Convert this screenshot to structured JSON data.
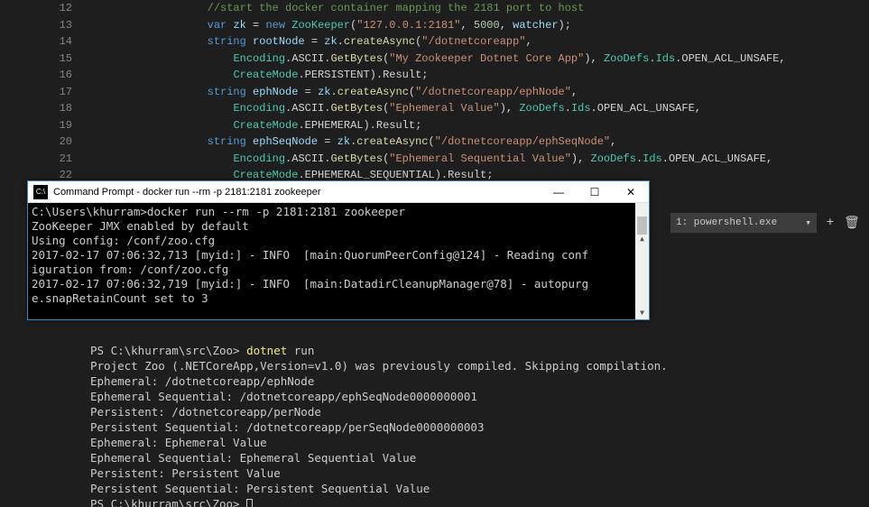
{
  "editor": {
    "lines": [
      {
        "n": 12,
        "indent": "                  ",
        "tokens": [
          {
            "cls": "c-comment",
            "t": "//start the docker container mapping the 2181 port to host"
          }
        ]
      },
      {
        "n": 13,
        "indent": "                  ",
        "tokens": [
          {
            "cls": "c-keyword",
            "t": "var"
          },
          {
            "cls": "c-punct",
            "t": " "
          },
          {
            "cls": "c-ident",
            "t": "zk"
          },
          {
            "cls": "c-punct",
            "t": " = "
          },
          {
            "cls": "c-keyword",
            "t": "new"
          },
          {
            "cls": "c-punct",
            "t": " "
          },
          {
            "cls": "c-type",
            "t": "ZooKeeper"
          },
          {
            "cls": "c-punct",
            "t": "("
          },
          {
            "cls": "c-string",
            "t": "\"127.0.0.1:2181\""
          },
          {
            "cls": "c-punct",
            "t": ", "
          },
          {
            "cls": "c-number",
            "t": "5000"
          },
          {
            "cls": "c-punct",
            "t": ", "
          },
          {
            "cls": "c-ident",
            "t": "watcher"
          },
          {
            "cls": "c-punct",
            "t": ");"
          }
        ]
      },
      {
        "n": 14,
        "indent": "                  ",
        "tokens": [
          {
            "cls": "c-keyword",
            "t": "string"
          },
          {
            "cls": "c-punct",
            "t": " "
          },
          {
            "cls": "c-ident",
            "t": "rootNode"
          },
          {
            "cls": "c-punct",
            "t": " = "
          },
          {
            "cls": "c-ident",
            "t": "zk"
          },
          {
            "cls": "c-punct",
            "t": "."
          },
          {
            "cls": "c-method",
            "t": "createAsync"
          },
          {
            "cls": "c-punct",
            "t": "("
          },
          {
            "cls": "c-string",
            "t": "\"/dotnetcoreapp\""
          },
          {
            "cls": "c-punct",
            "t": ","
          }
        ]
      },
      {
        "n": 15,
        "indent": "                      ",
        "tokens": [
          {
            "cls": "c-type",
            "t": "Encoding"
          },
          {
            "cls": "c-punct",
            "t": "."
          },
          {
            "cls": "c-member",
            "t": "ASCII"
          },
          {
            "cls": "c-punct",
            "t": "."
          },
          {
            "cls": "c-method",
            "t": "GetBytes"
          },
          {
            "cls": "c-punct",
            "t": "("
          },
          {
            "cls": "c-string",
            "t": "\"My Zookeeper Dotnet Core App\""
          },
          {
            "cls": "c-punct",
            "t": "), "
          },
          {
            "cls": "c-type",
            "t": "ZooDefs"
          },
          {
            "cls": "c-punct",
            "t": "."
          },
          {
            "cls": "c-type",
            "t": "Ids"
          },
          {
            "cls": "c-punct",
            "t": "."
          },
          {
            "cls": "c-member",
            "t": "OPEN_ACL_UNSAFE"
          },
          {
            "cls": "c-punct",
            "t": ","
          }
        ]
      },
      {
        "n": 16,
        "indent": "                      ",
        "tokens": [
          {
            "cls": "c-type",
            "t": "CreateMode"
          },
          {
            "cls": "c-punct",
            "t": "."
          },
          {
            "cls": "c-member",
            "t": "PERSISTENT"
          },
          {
            "cls": "c-punct",
            "t": ")."
          },
          {
            "cls": "c-member",
            "t": "Result"
          },
          {
            "cls": "c-punct",
            "t": ";"
          }
        ]
      },
      {
        "n": 17,
        "indent": "                  ",
        "tokens": [
          {
            "cls": "c-keyword",
            "t": "string"
          },
          {
            "cls": "c-punct",
            "t": " "
          },
          {
            "cls": "c-ident",
            "t": "ephNode"
          },
          {
            "cls": "c-punct",
            "t": " = "
          },
          {
            "cls": "c-ident",
            "t": "zk"
          },
          {
            "cls": "c-punct",
            "t": "."
          },
          {
            "cls": "c-method",
            "t": "createAsync"
          },
          {
            "cls": "c-punct",
            "t": "("
          },
          {
            "cls": "c-string",
            "t": "\"/dotnetcoreapp/ephNode\""
          },
          {
            "cls": "c-punct",
            "t": ","
          }
        ]
      },
      {
        "n": 18,
        "indent": "                      ",
        "tokens": [
          {
            "cls": "c-type",
            "t": "Encoding"
          },
          {
            "cls": "c-punct",
            "t": "."
          },
          {
            "cls": "c-member",
            "t": "ASCII"
          },
          {
            "cls": "c-punct",
            "t": "."
          },
          {
            "cls": "c-method",
            "t": "GetBytes"
          },
          {
            "cls": "c-punct",
            "t": "("
          },
          {
            "cls": "c-string",
            "t": "\"Ephemeral Value\""
          },
          {
            "cls": "c-punct",
            "t": "), "
          },
          {
            "cls": "c-type",
            "t": "ZooDefs"
          },
          {
            "cls": "c-punct",
            "t": "."
          },
          {
            "cls": "c-type",
            "t": "Ids"
          },
          {
            "cls": "c-punct",
            "t": "."
          },
          {
            "cls": "c-member",
            "t": "OPEN_ACL_UNSAFE"
          },
          {
            "cls": "c-punct",
            "t": ","
          }
        ]
      },
      {
        "n": 19,
        "indent": "                      ",
        "tokens": [
          {
            "cls": "c-type",
            "t": "CreateMode"
          },
          {
            "cls": "c-punct",
            "t": "."
          },
          {
            "cls": "c-member",
            "t": "EPHEMERAL"
          },
          {
            "cls": "c-punct",
            "t": ")."
          },
          {
            "cls": "c-member",
            "t": "Result"
          },
          {
            "cls": "c-punct",
            "t": ";"
          }
        ]
      },
      {
        "n": 20,
        "indent": "                  ",
        "tokens": [
          {
            "cls": "c-keyword",
            "t": "string"
          },
          {
            "cls": "c-punct",
            "t": " "
          },
          {
            "cls": "c-ident",
            "t": "ephSeqNode"
          },
          {
            "cls": "c-punct",
            "t": " = "
          },
          {
            "cls": "c-ident",
            "t": "zk"
          },
          {
            "cls": "c-punct",
            "t": "."
          },
          {
            "cls": "c-method",
            "t": "createAsync"
          },
          {
            "cls": "c-punct",
            "t": "("
          },
          {
            "cls": "c-string",
            "t": "\"/dotnetcoreapp/ephSeqNode\""
          },
          {
            "cls": "c-punct",
            "t": ","
          }
        ]
      },
      {
        "n": 21,
        "indent": "                      ",
        "tokens": [
          {
            "cls": "c-type",
            "t": "Encoding"
          },
          {
            "cls": "c-punct",
            "t": "."
          },
          {
            "cls": "c-member",
            "t": "ASCII"
          },
          {
            "cls": "c-punct",
            "t": "."
          },
          {
            "cls": "c-method",
            "t": "GetBytes"
          },
          {
            "cls": "c-punct",
            "t": "("
          },
          {
            "cls": "c-string",
            "t": "\"Ephemeral Sequential Value\""
          },
          {
            "cls": "c-punct",
            "t": "), "
          },
          {
            "cls": "c-type",
            "t": "ZooDefs"
          },
          {
            "cls": "c-punct",
            "t": "."
          },
          {
            "cls": "c-type",
            "t": "Ids"
          },
          {
            "cls": "c-punct",
            "t": "."
          },
          {
            "cls": "c-member",
            "t": "OPEN_ACL_UNSAFE"
          },
          {
            "cls": "c-punct",
            "t": ","
          }
        ]
      },
      {
        "n": 22,
        "indent": "                      ",
        "tokens": [
          {
            "cls": "c-type",
            "t": "CreateMode"
          },
          {
            "cls": "c-punct",
            "t": "."
          },
          {
            "cls": "c-member",
            "t": "EPHEMERAL_SEQUENTIAL"
          },
          {
            "cls": "c-punct",
            "t": ")."
          },
          {
            "cls": "c-member",
            "t": "Result"
          },
          {
            "cls": "c-punct",
            "t": ";"
          }
        ]
      }
    ]
  },
  "cmd": {
    "title": "Command Prompt - docker  run --rm -p 2181:2181 zookeeper",
    "icon_text": "C:\\",
    "min": "—",
    "max": "☐",
    "close": "✕",
    "lines": [
      "C:\\Users\\khurram>docker run --rm -p 2181:2181 zookeeper",
      "ZooKeeper JMX enabled by default",
      "Using config: /conf/zoo.cfg",
      "2017-02-17 07:06:32,713 [myid:] - INFO  [main:QuorumPeerConfig@124] - Reading conf",
      "iguration from: /conf/zoo.cfg",
      "2017-02-17 07:06:32,719 [myid:] - INFO  [main:DatadirCleanupManager@78] - autopurg",
      "e.snapRetainCount set to 3"
    ]
  },
  "termtab": {
    "selected": "1: powershell.exe",
    "chevron": "▾",
    "plus": "+",
    "trash": "🗑"
  },
  "terminal": {
    "lines": [
      {
        "segs": [
          {
            "t": "PS C:\\khurram\\src\\Zoo> "
          },
          {
            "cls": "ps-cmd",
            "t": "dotnet"
          },
          {
            "t": " run"
          }
        ]
      },
      {
        "segs": [
          {
            "t": "Project Zoo (.NETCoreApp,Version=v1.0) was previously compiled. Skipping compilation."
          }
        ]
      },
      {
        "segs": [
          {
            "t": "Ephemeral: /dotnetcoreapp/ephNode"
          }
        ]
      },
      {
        "segs": [
          {
            "t": "Ephemeral Sequential: /dotnetcoreapp/ephSeqNode0000000001"
          }
        ]
      },
      {
        "segs": [
          {
            "t": "Persistent: /dotnetcoreapp/perNode"
          }
        ]
      },
      {
        "segs": [
          {
            "t": "Persistent Sequential: /dotnetcoreapp/perSeqNode0000000003"
          }
        ]
      },
      {
        "segs": [
          {
            "t": "Ephemeral: Ephemeral Value"
          }
        ]
      },
      {
        "segs": [
          {
            "t": "Ephemeral Sequential: Ephemeral Sequential Value"
          }
        ]
      },
      {
        "segs": [
          {
            "t": "Persistent: Persistent Value"
          }
        ]
      },
      {
        "segs": [
          {
            "t": "Persistent Sequential: Persistent Sequential Value"
          }
        ]
      },
      {
        "segs": [
          {
            "t": "PS C:\\khurram\\src\\Zoo> "
          }
        ],
        "cursor": true
      }
    ]
  }
}
